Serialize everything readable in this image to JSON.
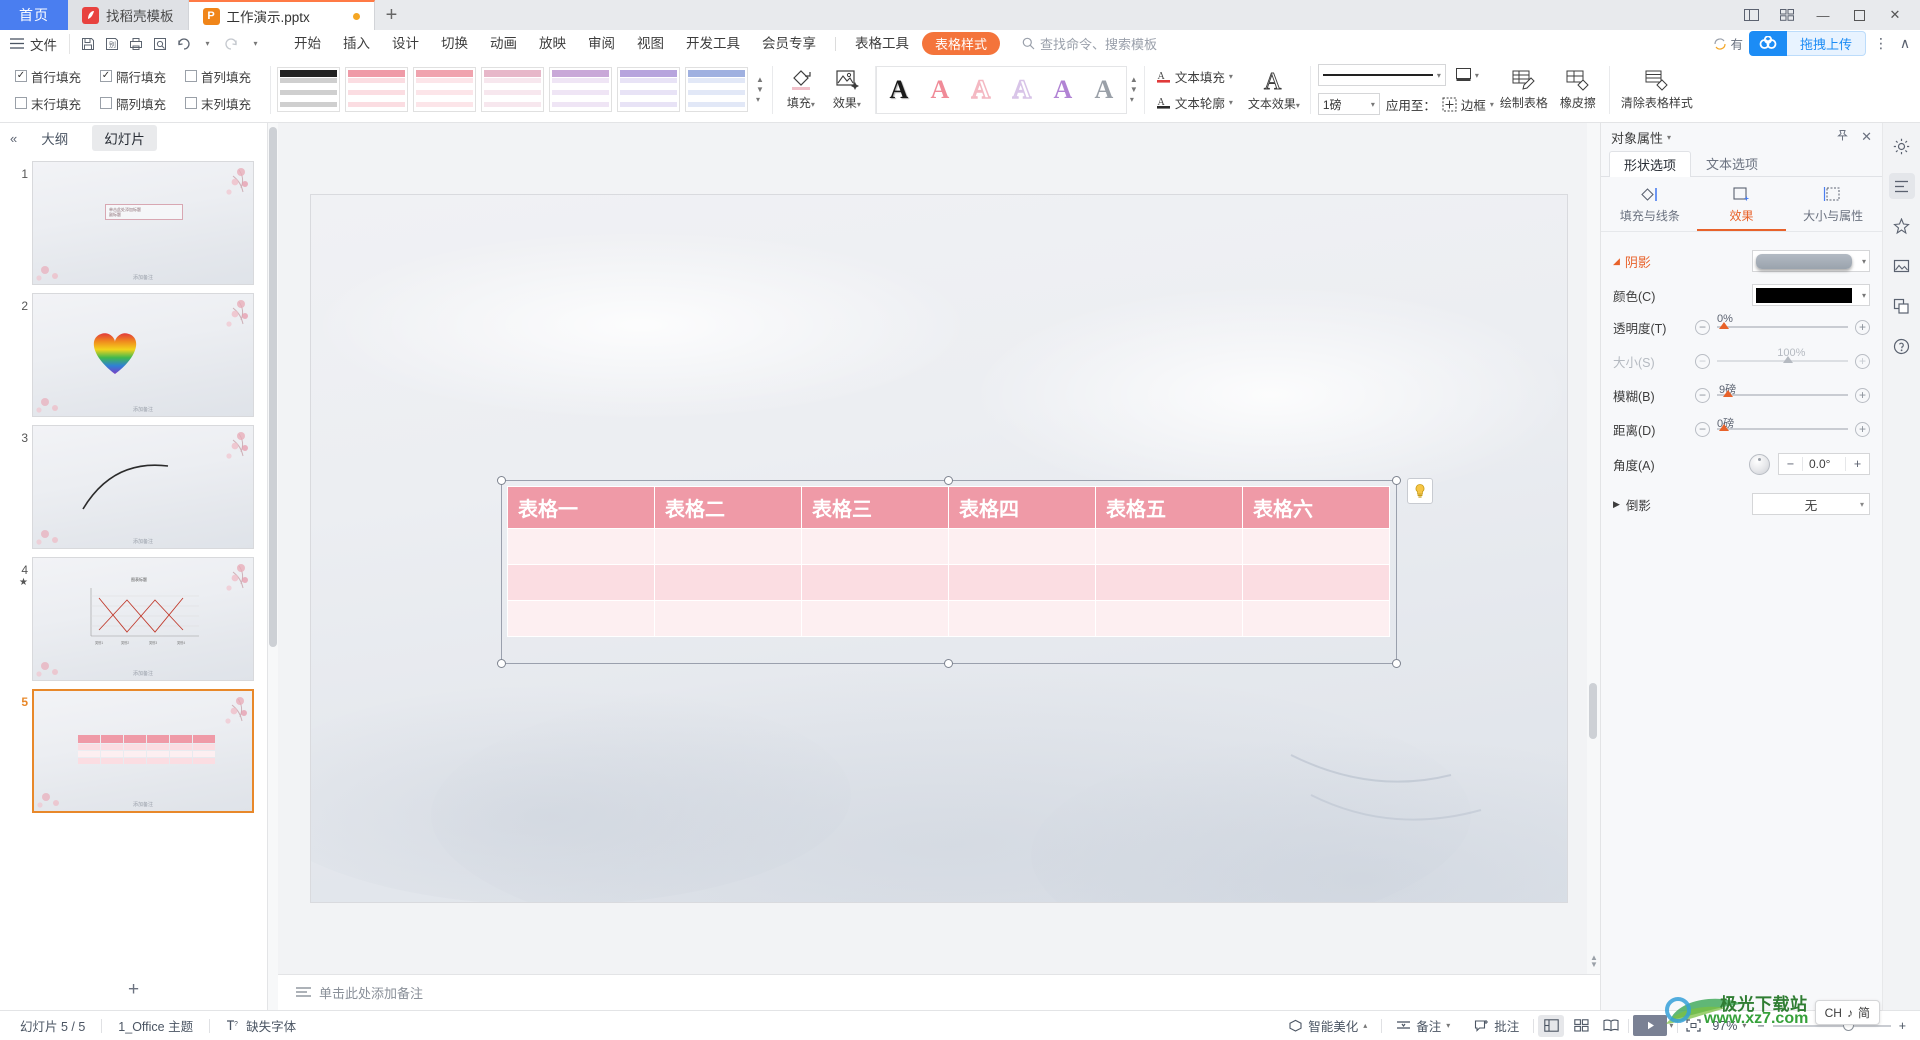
{
  "window": {
    "tabs": [
      {
        "label": "首页",
        "type": "home"
      },
      {
        "label": "找稻壳模板",
        "icon": "docer-icon",
        "active": false
      },
      {
        "label": "工作演示.pptx",
        "icon": "ppt-icon",
        "active": true,
        "modified": true
      }
    ],
    "new_tab_label": "+",
    "controls": {
      "minimize": "—",
      "maximize": "▫",
      "close": "✕",
      "layout": "▤",
      "grid": "▦"
    }
  },
  "menubar": {
    "hamburger": "menu-icon",
    "file": "文件",
    "quick_access": [
      "save-icon",
      "save-as-icon",
      "print-icon",
      "print-preview-icon",
      "undo-icon",
      "redo-icon",
      "customize-icon"
    ],
    "items": [
      "开始",
      "插入",
      "设计",
      "切换",
      "动画",
      "放映",
      "审阅",
      "视图",
      "开发工具",
      "会员专享"
    ],
    "context_tabs": [
      {
        "label": "表格工具",
        "active": false
      },
      {
        "label": "表格样式",
        "active": true
      }
    ],
    "search_placeholder": "查找命令、搜索模板",
    "share_label": "有",
    "upload_label": "拖拽上传",
    "more": "⋮",
    "collapse": "∧"
  },
  "ribbon": {
    "checkboxes": [
      {
        "label": "首行填充",
        "checked": true
      },
      {
        "label": "隔行填充",
        "checked": true
      },
      {
        "label": "首列填充",
        "checked": false
      },
      {
        "label": "末行填充",
        "checked": false
      },
      {
        "label": "隔列填充",
        "checked": false
      },
      {
        "label": "末列填充",
        "checked": false
      }
    ],
    "style_gallery": [
      {
        "header": "#222222",
        "row": "#cfcfcf"
      },
      {
        "header": "#ef9aa7",
        "row": "#fbdde2"
      },
      {
        "header": "#f0a3ae",
        "row": "#fce5e9"
      },
      {
        "header": "#e7b7c9",
        "row": "#f7e7ee"
      },
      {
        "header": "#c9a8d8",
        "row": "#efe5f5"
      },
      {
        "header": "#b7a4dd",
        "row": "#e8e3f6"
      },
      {
        "header": "#9fb0e0",
        "row": "#e2e8f7"
      }
    ],
    "gallery_nav": {
      "up": "▲",
      "down": "▼",
      "more": "▾"
    },
    "fill_label": "填充",
    "effect_label": "效果",
    "wordart": [
      "#1a1a1a",
      "#f08b98",
      "#f4b8c2",
      "#d8c4e8",
      "#b183d4",
      "#9aa0a8"
    ],
    "text_fill_label": "文本填充",
    "text_outline_label": "文本轮廓",
    "text_effect_label": "文本效果",
    "line_width_value": "1磅",
    "apply_to_label": "应用至：",
    "border_label": "边框",
    "draw_table_label": "绘制表格",
    "eraser_label": "橡皮擦",
    "clear_style_label": "清除表格样式"
  },
  "slide_panel": {
    "collapse_icon": "chevron-left-icon",
    "tabs": [
      {
        "label": "大纲",
        "active": false
      },
      {
        "label": "幻灯片",
        "active": true
      }
    ],
    "slides": [
      {
        "number": "1",
        "selected": false,
        "kind": "title"
      },
      {
        "number": "2",
        "selected": false,
        "kind": "heart"
      },
      {
        "number": "3",
        "selected": false,
        "kind": "arc"
      },
      {
        "number": "4",
        "selected": false,
        "kind": "chart",
        "starred": true
      },
      {
        "number": "5",
        "selected": true,
        "kind": "table"
      }
    ],
    "thumb_note": "添加备注",
    "add_slide_label": "+"
  },
  "slide": {
    "table": {
      "headers": [
        "表格一",
        "表格二",
        "表格三",
        "表格四",
        "表格五",
        "表格六"
      ],
      "body_rows": 3,
      "header_color": "#ef9aa7",
      "row_odd_color": "#fbdde2",
      "row_even_color": "#fdeff1"
    },
    "smart_button": "smart-layout-icon",
    "notes_placeholder": "单击此处添加备注",
    "notes_icon": "notes-icon"
  },
  "right_panel": {
    "title": "对象属性",
    "pin_icon": "pin-icon",
    "close_icon": "close-icon",
    "tabs": [
      {
        "label": "形状选项",
        "active": true
      },
      {
        "label": "文本选项",
        "active": false
      }
    ],
    "sections": [
      {
        "label": "填充与线条",
        "icon": "fill-line-icon",
        "active": false
      },
      {
        "label": "效果",
        "icon": "effects-icon",
        "active": true
      },
      {
        "label": "大小与属性",
        "icon": "size-props-icon",
        "active": false
      }
    ],
    "shadow": {
      "title": "阴影",
      "preset_swatch": "#9aa3ad",
      "rows": [
        {
          "label": "颜色(C)",
          "type": "color",
          "value": "#000000"
        },
        {
          "label": "透明度(T)",
          "type": "slider",
          "value": "0%",
          "pos": 2,
          "disabled": false
        },
        {
          "label": "大小(S)",
          "type": "slider",
          "value": "100%",
          "pos": 50,
          "disabled": true
        },
        {
          "label": "模糊(B)",
          "type": "slider",
          "value": "9磅",
          "pos": 6,
          "disabled": false
        },
        {
          "label": "距离(D)",
          "type": "slider",
          "value": "0磅",
          "pos": 2,
          "disabled": false
        },
        {
          "label": "角度(A)",
          "type": "spinner",
          "value": "0.0°",
          "minus": "−",
          "plus": "+"
        }
      ]
    },
    "reflection": {
      "label": "倒影",
      "value": "无",
      "expand_icon": "triangle-right-icon"
    }
  },
  "right_rail": [
    {
      "icon": "settings-rail-icon",
      "active": false
    },
    {
      "icon": "format-rail-icon",
      "active": true
    },
    {
      "icon": "animation-rail-icon",
      "active": false
    },
    {
      "icon": "gallery-rail-icon",
      "active": false
    },
    {
      "icon": "layers-rail-icon",
      "active": false
    },
    {
      "icon": "help-rail-icon",
      "active": false
    }
  ],
  "status_bar": {
    "slide_count": "幻灯片 5 / 5",
    "theme": "1_Office 主题",
    "missing_font": "缺失字体",
    "missing_font_icon": "font-warning-icon",
    "beautify": "智能美化",
    "notes": "备注",
    "comments": "批注",
    "views": [
      {
        "icon": "normal-view-icon",
        "active": true
      },
      {
        "icon": "slide-sorter-icon",
        "active": false
      },
      {
        "icon": "reading-view-icon",
        "active": false
      }
    ],
    "play_icon": "play-icon",
    "fit_icon": "fit-to-window-icon",
    "zoom": "97%",
    "zoom_minus": "−",
    "zoom_plus": "+"
  },
  "ime": {
    "lang": "CH",
    "mode_icon": "♪",
    "style": "简"
  },
  "watermark": {
    "line1": "极光下载站",
    "line2": "www.xz7.com"
  }
}
